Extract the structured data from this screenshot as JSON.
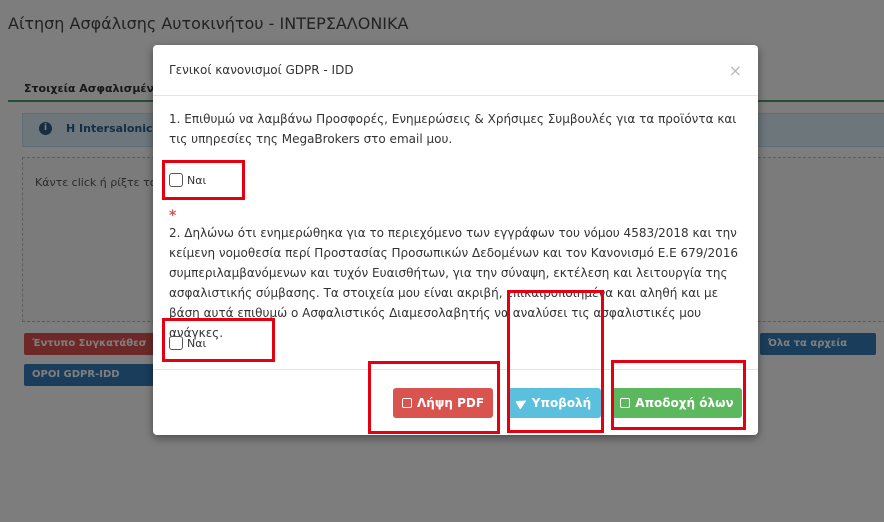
{
  "background": {
    "title": "Αίτηση Ασφάλισης Αυτοκινήτου - ΙΝΤΕΡΣΑΛΟΝΙΚΑ",
    "tab_label": "Στοιχεία Ασφαλισμένου",
    "info_text": "Η Intersalonica α",
    "dropzone_text": "Κάντε click ή ρίξτε τα αρ",
    "btn_consent_form": "Έντυπο Συγκατάθεσ",
    "btn_gdpr_terms": "ΟΡΟΙ GDPR-IDD",
    "btn_all_files": "Όλα τα αρχεία"
  },
  "modal": {
    "title": "Γενικοί κανονισμοί GDPR - IDD",
    "close_glyph": "×",
    "question1": "1. Επιθυμώ να λαμβάνω Προσφορές, Ενημερώσεις & Χρήσιμες Συμβουλές για τα προϊόντα και τις υπηρεσίες της MegaBrokers στο email μου.",
    "checkbox1_label": "Ναι",
    "required_marker": "*",
    "question2": "2. Δηλώνω ότι ενημερώθηκα για το περιεχόμενο των εγγράφων του νόμου 4583/2018 και την κείμενη νομοθεσία περί Προστασίας Προσωπικών Δεδομένων και τον Κανονισμό Ε.Ε 679/2016 συμπεριλαμβανόμενων και τυχόν Ευαισθήτων, για την σύναψη, εκτέλεση και λειτουργία της ασφαλιστικής σύμβασης. Τα στοιχεία μου είναι ακριβή, επικαιροποιημένα και αληθή και με βάση αυτά επιθυμώ ο Ασφαλιστικός Διαμεσολαβητής να αναλύσει τις ασφαλιστικές μου ανάγκες.",
    "checkbox2_label": "Ναι",
    "btn_pdf": "Λήψη PDF",
    "btn_submit": "Υποβολή",
    "btn_accept_all": "Αποδοχή όλων"
  },
  "colors": {
    "danger": "#d9534f",
    "info": "#5bc0de",
    "success": "#5cb85c",
    "annotation": "#e3000f"
  },
  "icons": [
    "file-pdf-icon",
    "paper-plane-icon",
    "save-icon",
    "info-circle-icon",
    "close-icon"
  ]
}
